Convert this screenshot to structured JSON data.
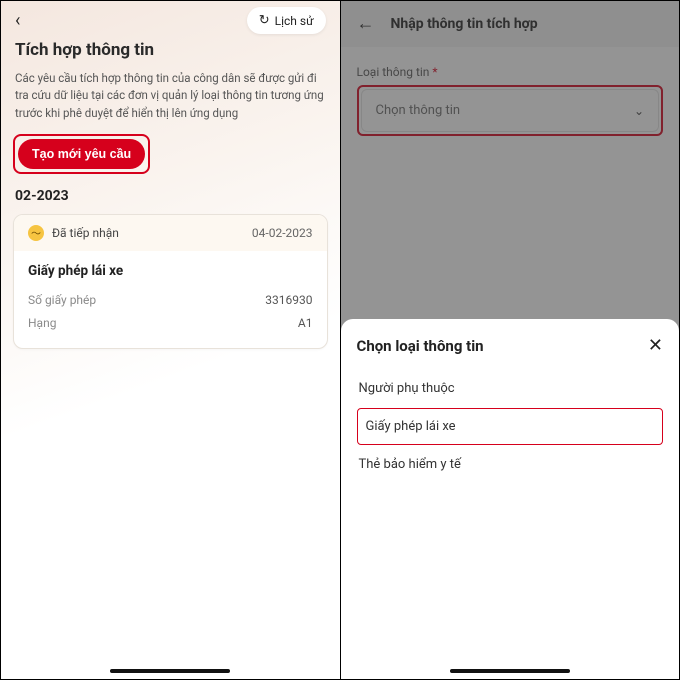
{
  "left": {
    "title": "Tích hợp thông tin",
    "history_label": "Lịch sử",
    "description": "Các yêu cầu tích hợp thông tin của công dân sẽ được gửi đi tra cứu dữ liệu tại các đơn vị quản lý loại thông tin tương ứng trước khi phê duyệt để hiển thị lên ứng dụng",
    "create_label": "Tạo mới yêu cầu",
    "month_heading": "02-2023",
    "card": {
      "status": "Đã tiếp nhận",
      "date": "04-02-2023",
      "title": "Giấy phép lái xe",
      "rows": [
        {
          "k": "Số giấy phép",
          "v": "3316930"
        },
        {
          "k": "Hạng",
          "v": "A1"
        }
      ]
    }
  },
  "right": {
    "title": "Nhập thông tin tích hợp",
    "field_label": "Loại thông tin",
    "select_placeholder": "Chọn thông tin",
    "sheet": {
      "title": "Chọn loại thông tin",
      "options": [
        "Người phụ thuộc",
        "Giấy phép lái xe",
        "Thẻ bảo hiểm y tế"
      ]
    }
  }
}
